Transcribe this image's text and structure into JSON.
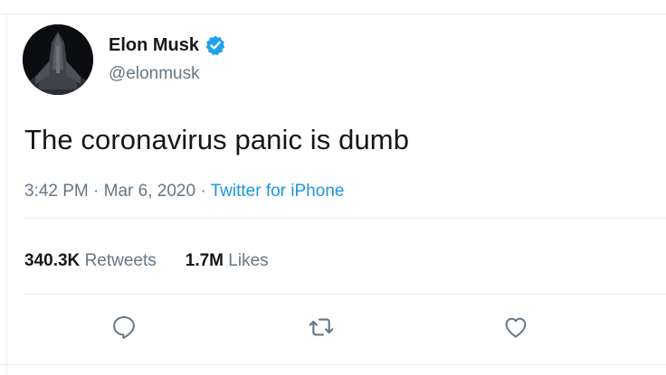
{
  "tweet": {
    "author": {
      "display_name": "Elon Musk",
      "handle": "@elonmusk",
      "verified": true,
      "avatar_icon": "avatar-image"
    },
    "text": "The coronavirus panic is dumb",
    "time": "3:42 PM",
    "date": "Mar 6, 2020",
    "separator": "·",
    "source": "Twitter for iPhone"
  },
  "stats": {
    "retweets_count": "340.3K",
    "retweets_label": "Retweets",
    "likes_count": "1.7M",
    "likes_label": "Likes"
  },
  "actions": [
    {
      "icon": "reply-icon"
    },
    {
      "icon": "retweet-icon"
    },
    {
      "icon": "like-icon"
    }
  ],
  "colors": {
    "text_primary": "#14171a",
    "text_secondary": "#657786",
    "link": "#1b95e0",
    "verified": "#1da1f2",
    "border": "#e6ecf0"
  }
}
